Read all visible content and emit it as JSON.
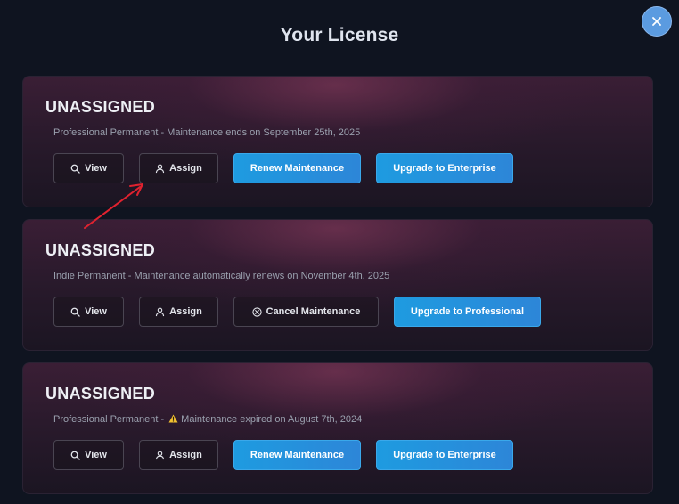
{
  "modal": {
    "title": "Your License",
    "close_icon": "close-icon"
  },
  "licenses": [
    {
      "status": "UNASSIGNED",
      "description": "Professional Permanent - Maintenance ends on September 25th, 2025",
      "buttons": {
        "view": "View",
        "assign": "Assign",
        "action": "Renew Maintenance",
        "upgrade": "Upgrade to Enterprise"
      }
    },
    {
      "status": "UNASSIGNED",
      "description": "Indie Permanent - Maintenance automatically renews on November 4th, 2025",
      "buttons": {
        "view": "View",
        "assign": "Assign",
        "action": "Cancel Maintenance",
        "upgrade": "Upgrade to Professional"
      }
    },
    {
      "status": "UNASSIGNED",
      "description_prefix": "Professional Permanent - ",
      "description_warning": "Maintenance expired on August 7th, 2024",
      "buttons": {
        "view": "View",
        "assign": "Assign",
        "action": "Renew Maintenance",
        "upgrade": "Upgrade to Enterprise"
      }
    }
  ],
  "colors": {
    "primary_button": "#1e9be0",
    "close_button": "#5b9be0",
    "annotation_arrow": "#e0222f",
    "warning_icon": "#f2c230"
  },
  "icons": [
    "search-icon",
    "user-icon",
    "cancel-circle-icon",
    "warning-icon",
    "close-icon"
  ]
}
